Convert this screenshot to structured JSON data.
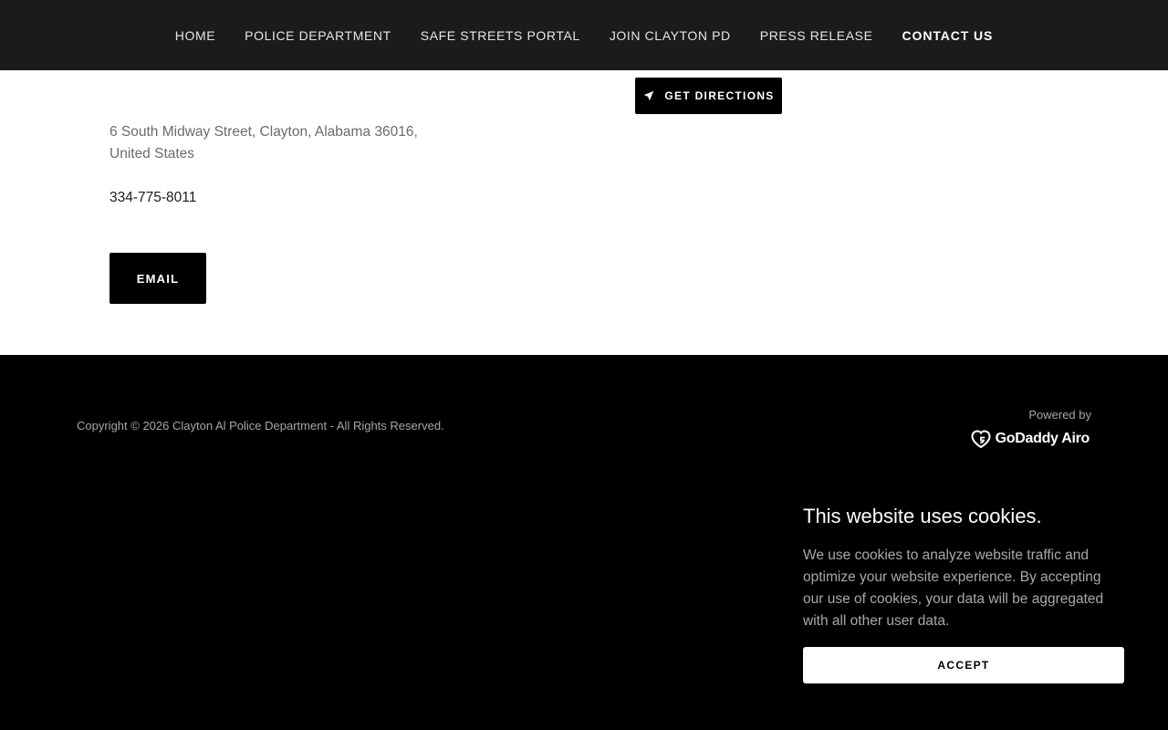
{
  "nav": {
    "items": [
      {
        "label": "HOME",
        "active": false
      },
      {
        "label": "POLICE DEPARTMENT",
        "active": false
      },
      {
        "label": "SAFE STREETS PORTAL",
        "active": false
      },
      {
        "label": "JOIN CLAYTON PD",
        "active": false
      },
      {
        "label": "PRESS RELEASE",
        "active": false
      },
      {
        "label": "CONTACT US",
        "active": true
      }
    ]
  },
  "contact": {
    "directions_label": "GET DIRECTIONS",
    "directions_icon": "navigation-arrow-icon",
    "address_line1": "6 South Midway Street, Clayton, Alabama 36016,",
    "address_line2": "United States",
    "phone": "334-775-8011",
    "email_label": "EMAIL"
  },
  "footer": {
    "copyright": "Copyright © 2026 Clayton Al Police Department - All Rights Reserved.",
    "powered_by": "Powered by",
    "brand": "GoDaddy Airo",
    "brand_icon": "godaddy-heart-icon"
  },
  "cookie": {
    "title": "This website uses cookies.",
    "text": "We use cookies to analyze website traffic and optimize your website experience. By accepting our use of cookies, your data will be aggregated with all other user data.",
    "accept_label": "ACCEPT"
  },
  "colors": {
    "nav_bg": "#1b1b1b",
    "content_bg": "#ffffff",
    "footer_bg": "#000000",
    "button_bg": "#000000",
    "accept_bg": "#ffffff"
  }
}
